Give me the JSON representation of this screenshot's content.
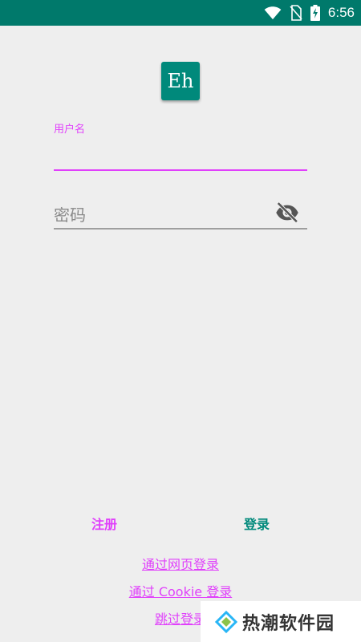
{
  "status_bar": {
    "time": "6:56",
    "icons": [
      "wifi-icon",
      "no-sim-icon",
      "battery-charging-icon"
    ],
    "color": "#00796b"
  },
  "app": {
    "logo_text": "Eh",
    "logo_color": "#00897b"
  },
  "form": {
    "username_label": "用户名",
    "username_value": "",
    "password_placeholder": "密码",
    "password_toggle_icon": "visibility-off-icon",
    "accent_color": "#e040fb"
  },
  "actions": {
    "register_label": "注册",
    "login_label": "登录"
  },
  "links": {
    "web_login": "通过网页登录",
    "cookie_login": "通过 Cookie 登录",
    "skip_login": "跳过登录"
  },
  "watermark": {
    "text": "热潮软件园"
  }
}
